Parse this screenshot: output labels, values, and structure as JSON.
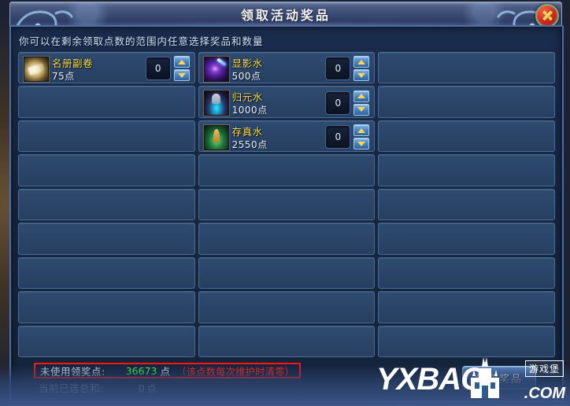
{
  "window": {
    "title": "领取活动奖品",
    "close_label": "×",
    "hint": "你可以在剩余领取点数的范围内任意选择奖品和数量"
  },
  "grid": {
    "columns": 3,
    "rows": 9,
    "items": [
      {
        "row": 0,
        "col": 0,
        "name": "名册副卷",
        "cost": "75点",
        "qty": "0",
        "icon": "scroll-icon"
      },
      {
        "row": 0,
        "col": 1,
        "name": "显影水",
        "cost": "500点",
        "qty": "0",
        "icon": "purple-vial-icon"
      },
      {
        "row": 1,
        "col": 1,
        "name": "归元水",
        "cost": "1000点",
        "qty": "0",
        "icon": "cyan-flask-icon"
      },
      {
        "row": 2,
        "col": 1,
        "name": "存真水",
        "cost": "2550点",
        "qty": "0",
        "icon": "green-flask-icon"
      }
    ],
    "stepper": {
      "up_label": "▲",
      "down_label": "▼"
    }
  },
  "summary": {
    "unused_label": "未使用领奖点:",
    "unused_value": "36673",
    "unused_unit": "点",
    "unused_note": "（该点数每次维护时清零）",
    "total_label": "当前已选总和:",
    "total_value": "0",
    "total_unit": "点",
    "confirm_label": "领取奖品"
  },
  "watermark": {
    "main": "YXBAO",
    "suffix": ".COM",
    "badge": "游戏堡"
  },
  "colors": {
    "title_text": "#f4f1e8",
    "item_name": "#f3e46a",
    "points_value": "#4dff5a",
    "note_red": "#ff2a2a",
    "red_box_border": "#ff1414",
    "cell_fill": "#2b4668",
    "cell_border": "#4a6b96",
    "panel_bg": "#16263f",
    "arrow_yellow": "#ffd84a"
  }
}
